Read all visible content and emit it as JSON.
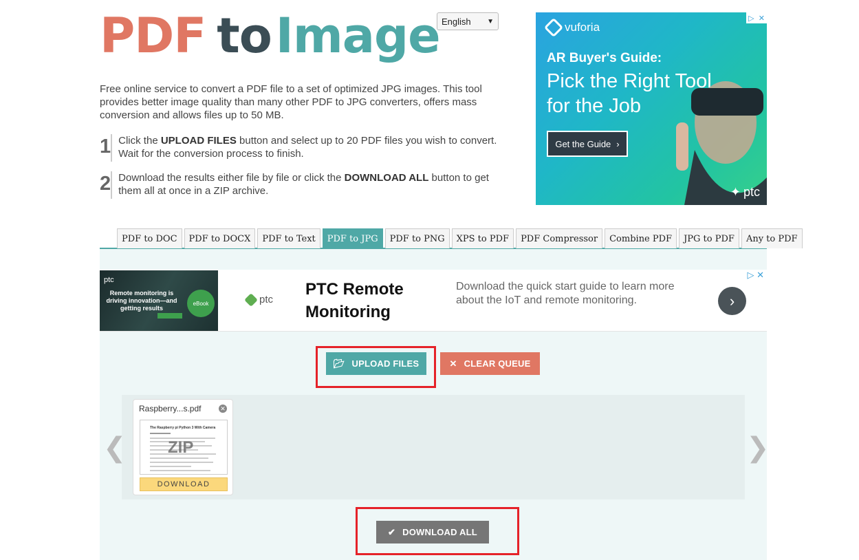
{
  "logo": {
    "pdf": "PDF",
    "to": "to",
    "image": "Image"
  },
  "language": {
    "selected": "English"
  },
  "intro": "Free online service to convert a PDF file to a set of optimized JPG images. This tool provides better image quality than many other PDF to JPG converters, offers mass conversion and allows files up to 50 MB.",
  "steps": [
    {
      "num": "1",
      "pre": "Click the ",
      "bold": "UPLOAD FILES",
      "post": " button and select up to 20 PDF files you wish to convert. Wait for the conversion process to finish."
    },
    {
      "num": "2",
      "pre": "Download the results either file by file or click the ",
      "bold": "DOWNLOAD ALL",
      "post": " button to get them all at once in a ZIP archive."
    }
  ],
  "ad_right": {
    "brand": "vuforia",
    "headline": "AR Buyer's Guide:",
    "subline": "Pick the Right Tool for the Job",
    "cta": "Get the Guide",
    "sponsor": "ptc"
  },
  "tabs": [
    "PDF to DOC",
    "PDF to DOCX",
    "PDF to Text",
    "PDF to JPG",
    "PDF to PNG",
    "XPS to PDF",
    "PDF Compressor",
    "Combine PDF",
    "JPG to PDF",
    "Any to PDF"
  ],
  "active_tab": "PDF to JPG",
  "banner": {
    "thumb_logo": "ptc",
    "thumb_text": "Remote monitoring is driving innovation—and getting results",
    "thumb_badge": "eBook",
    "logo": "ptc",
    "title": "PTC Remote Monitoring",
    "description": "Download the quick start guide to learn more about the IoT and remote monitoring."
  },
  "buttons": {
    "upload": "UPLOAD FILES",
    "clear": "CLEAR QUEUE",
    "download_all": "DOWNLOAD ALL"
  },
  "queue": {
    "file_name": "Raspberry...s.pdf",
    "preview_title": "The Raspberry pi Python 3 With Camera",
    "preview_overlay": "ZIP",
    "download_label": "DOWNLOAD"
  },
  "colors": {
    "teal": "#4fa8a6",
    "coral": "#e07763",
    "dark": "#3b4d55",
    "highlight": "#e52229"
  }
}
